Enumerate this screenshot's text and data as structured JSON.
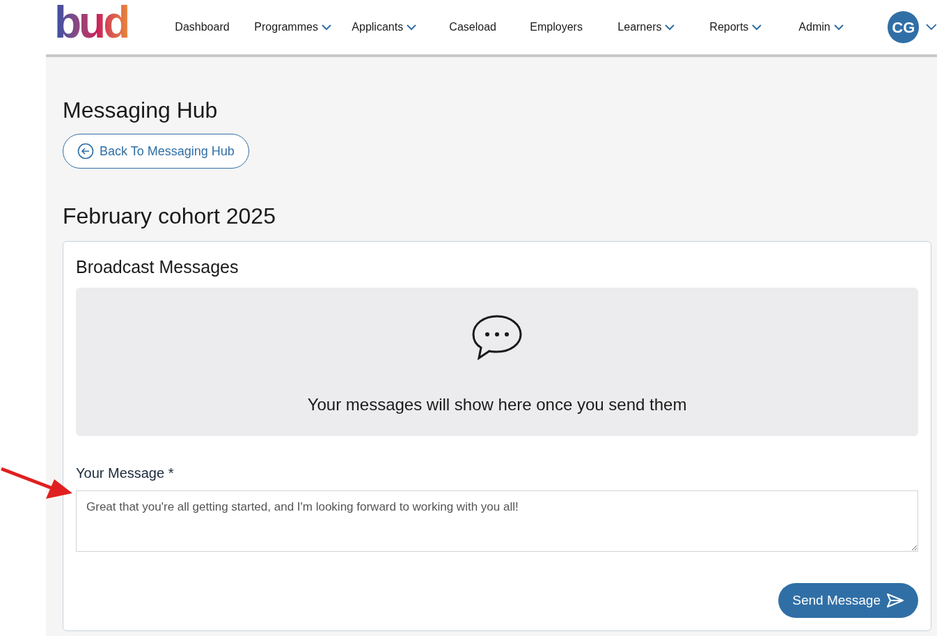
{
  "logo": {
    "text": "bud"
  },
  "nav": [
    {
      "label": "Dashboard",
      "dropdown": false
    },
    {
      "label": "Programmes",
      "dropdown": true
    },
    {
      "label": "Applicants",
      "dropdown": true
    },
    {
      "label": "Caseload",
      "dropdown": false
    },
    {
      "label": "Employers",
      "dropdown": false
    },
    {
      "label": "Learners",
      "dropdown": true
    },
    {
      "label": "Reports",
      "dropdown": true
    },
    {
      "label": "Admin",
      "dropdown": true
    }
  ],
  "user": {
    "initials": "CG"
  },
  "page_title": "Messaging Hub",
  "back_button": "Back To Messaging Hub",
  "group_title": "February cohort 2025",
  "card": {
    "title": "Broadcast Messages",
    "empty_state": "Your messages will show here once you send them",
    "message_label": "Your Message *",
    "message_value": "Great that you're all getting started, and I'm looking forward to working with you all!",
    "send_button": "Send Message"
  }
}
